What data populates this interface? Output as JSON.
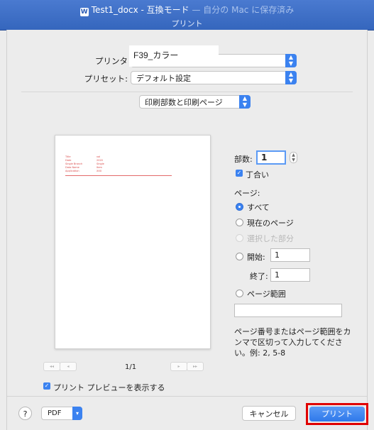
{
  "window": {
    "title_main": "Test1_docx - 互換モード",
    "title_suffix": " — 自分の Mac に保存済み",
    "word_icon": "W"
  },
  "sheet_title": "プリント",
  "printer": {
    "label": "プリンタ",
    "value": "F39_カラー"
  },
  "preset": {
    "label": "プリセット:",
    "value": "デフォルト設定"
  },
  "section_popup": {
    "value": "印刷部数と印刷ページ"
  },
  "copies": {
    "label": "部数:",
    "value": "1"
  },
  "collate": {
    "label": "丁合い",
    "checked": true
  },
  "pages": {
    "label": "ページ:",
    "options": [
      {
        "label": "すべて",
        "selected": true,
        "disabled": false
      },
      {
        "label": "現在のページ",
        "selected": false,
        "disabled": false
      },
      {
        "label": "選択した部分",
        "selected": false,
        "disabled": true
      }
    ],
    "from_label": "開始:",
    "from_value": "1",
    "to_label": "終了:",
    "to_value": "1",
    "range_label": "ページ範囲",
    "range_value": "",
    "help": "ページ番号またはページ範囲をカンマで区切って入力してください。例: 2, 5-8"
  },
  "preview": {
    "page_indicator": "1/1",
    "first_label": "◂◂",
    "prev_label": "◂",
    "next_label": "▸",
    "last_label": "▸▸",
    "show_preview_label": "プリント プレビューを表示する",
    "show_preview_checked": true,
    "doc_rows": [
      [
        "Title",
        "val"
      ],
      [
        "Date",
        "2020"
      ],
      [
        "Single Branch",
        "Single"
      ],
      [
        "Data Name",
        "Item"
      ],
      [
        "Application",
        "XXX"
      ]
    ]
  },
  "footer": {
    "help_label": "?",
    "pdf_label": "PDF",
    "cancel_label": "キャンセル",
    "print_label": "プリント"
  },
  "colors": {
    "accent": "#3b82f0",
    "highlight": "#e00000",
    "title_bar": "#3566bd"
  }
}
